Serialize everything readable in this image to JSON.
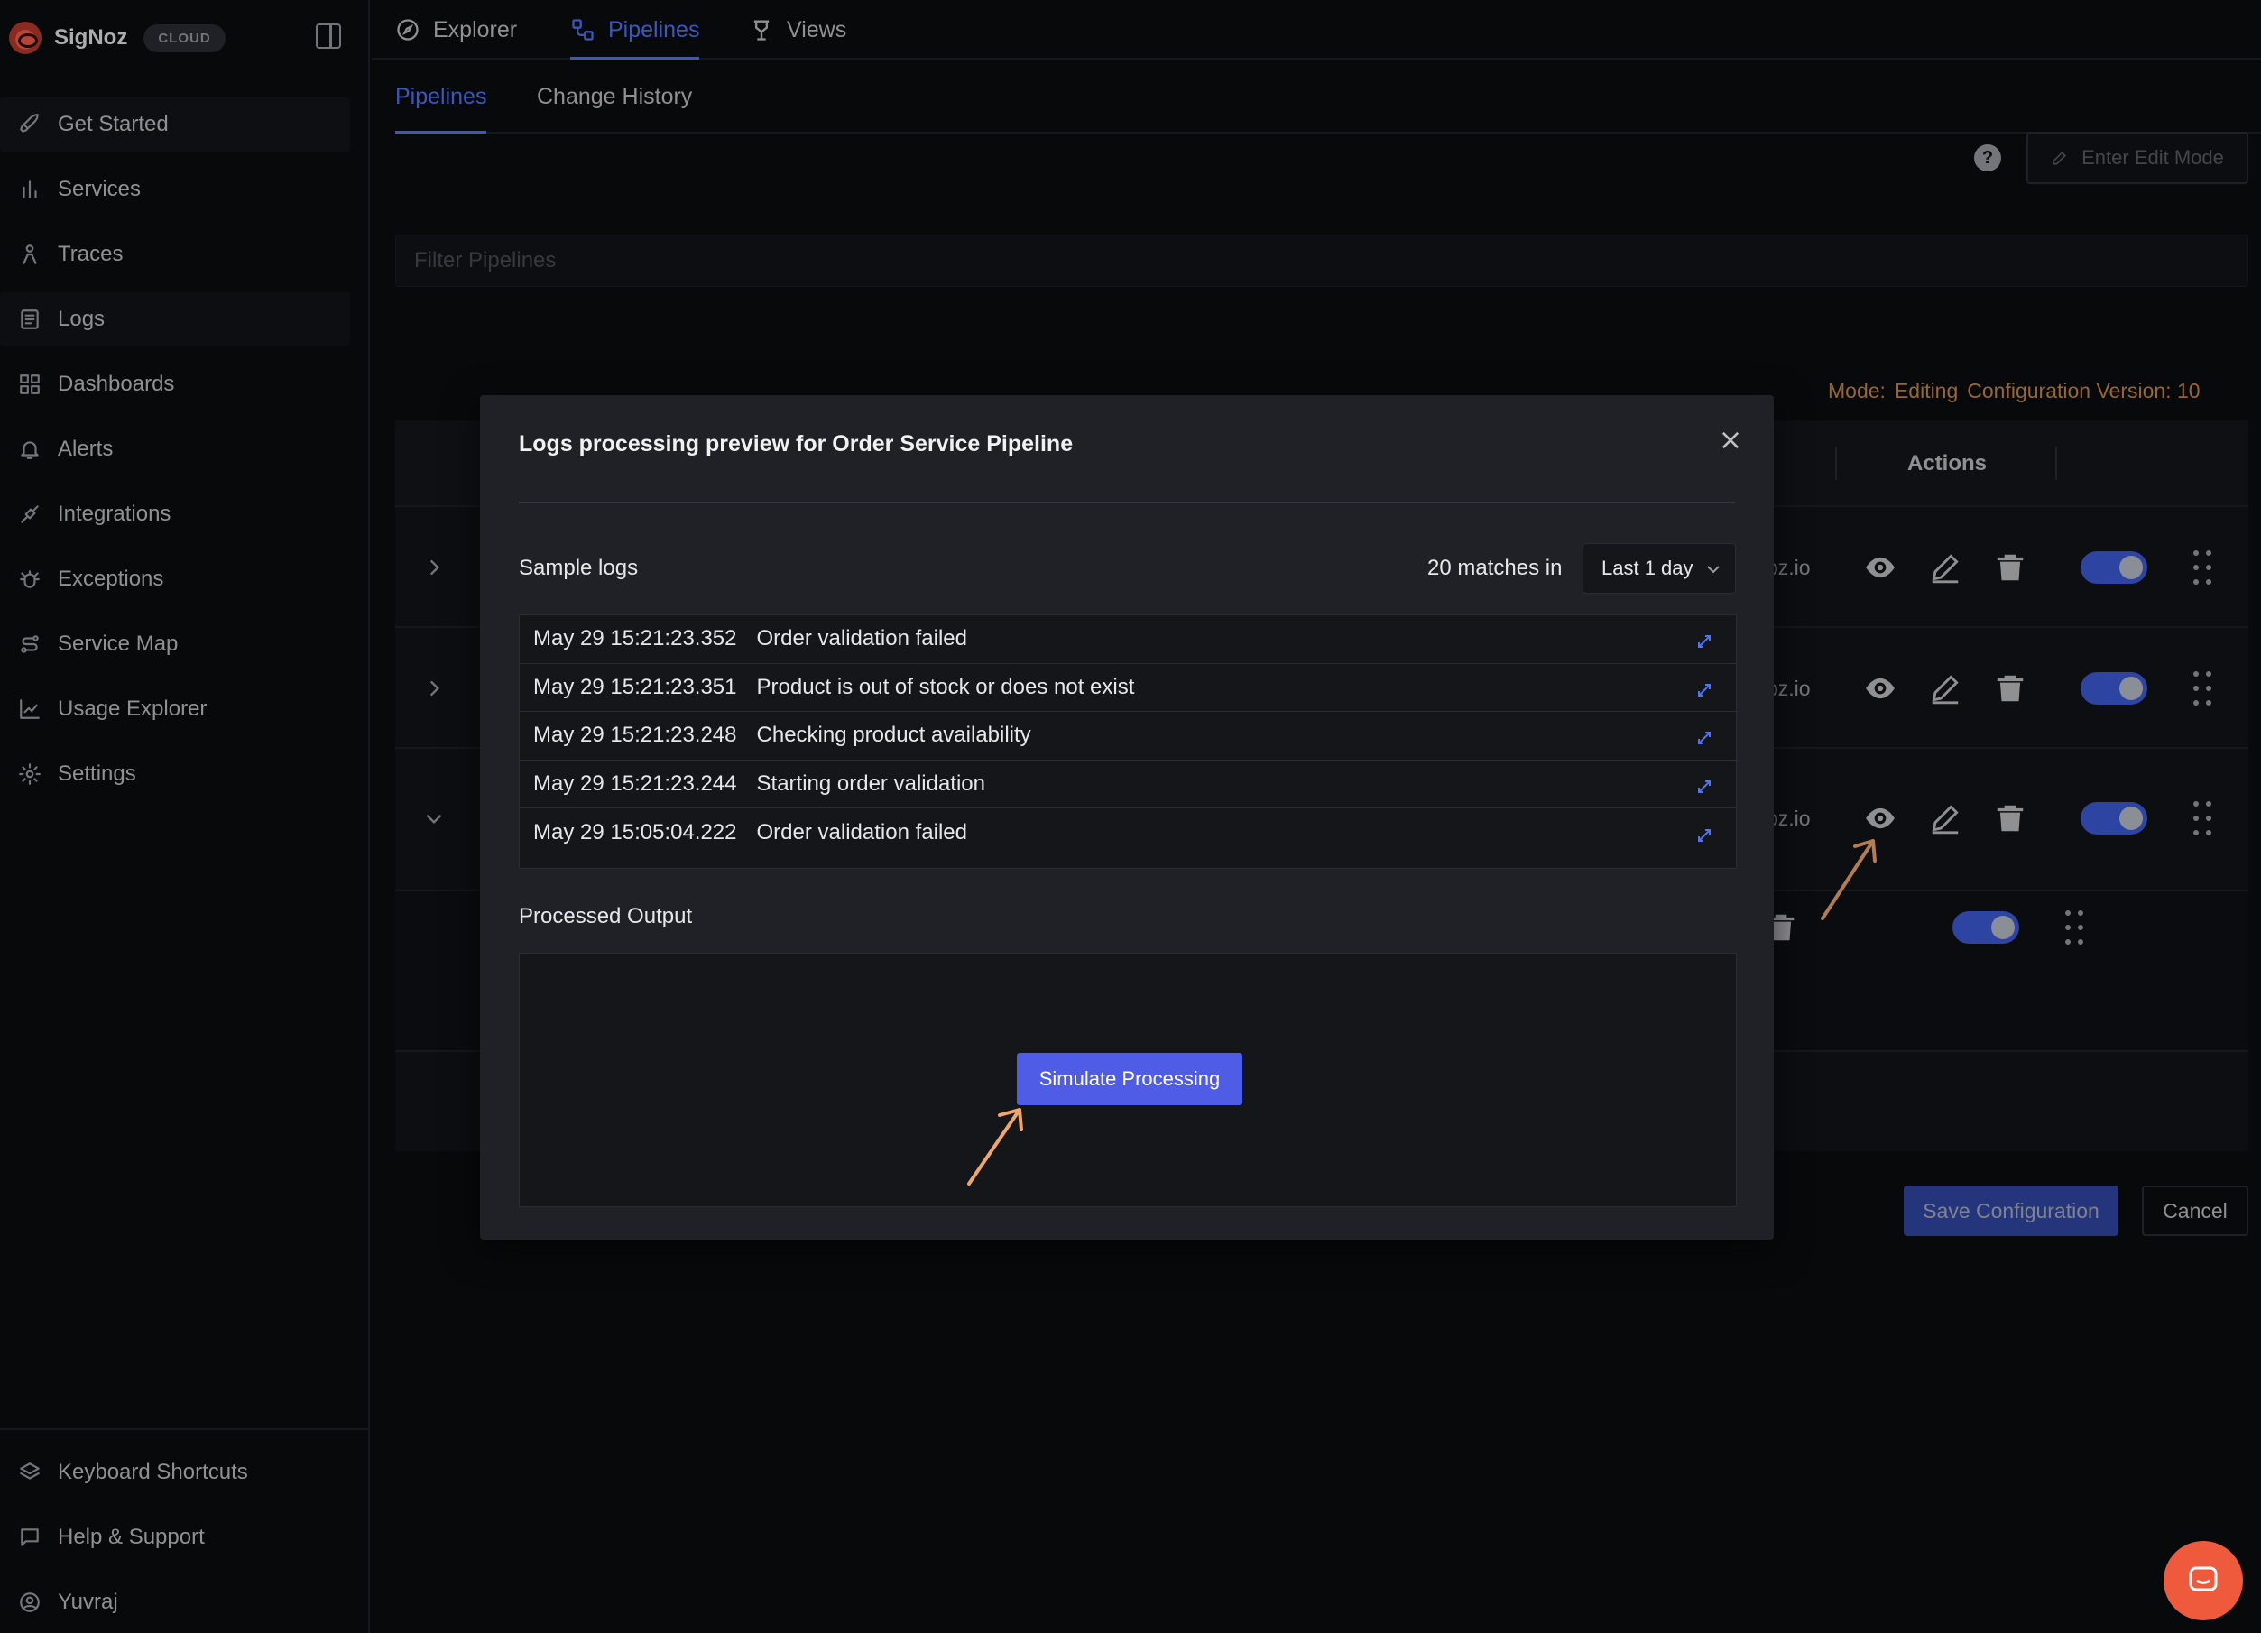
{
  "brand": {
    "name": "SigNoz",
    "badge": "CLOUD"
  },
  "sidebar": {
    "items": [
      {
        "label": "Get Started",
        "icon": "rocket-icon"
      },
      {
        "label": "Services",
        "icon": "bar-chart-icon"
      },
      {
        "label": "Traces",
        "icon": "traces-icon"
      },
      {
        "label": "Logs",
        "icon": "logs-icon"
      },
      {
        "label": "Dashboards",
        "icon": "dashboard-grid-icon"
      },
      {
        "label": "Alerts",
        "icon": "bell-icon"
      },
      {
        "label": "Integrations",
        "icon": "plug-icon"
      },
      {
        "label": "Exceptions",
        "icon": "bug-icon"
      },
      {
        "label": "Service Map",
        "icon": "route-icon"
      },
      {
        "label": "Usage Explorer",
        "icon": "line-chart-icon"
      },
      {
        "label": "Settings",
        "icon": "gear-icon"
      }
    ],
    "bottom": [
      {
        "label": "Keyboard Shortcuts",
        "icon": "layers-icon"
      },
      {
        "label": "Help & Support",
        "icon": "message-icon"
      },
      {
        "label": "Yuvraj",
        "icon": "user-circle-icon"
      }
    ]
  },
  "top_tabs": [
    {
      "label": "Explorer",
      "icon": "compass-icon"
    },
    {
      "label": "Pipelines",
      "icon": "workflow-icon"
    },
    {
      "label": "Views",
      "icon": "views-icon"
    }
  ],
  "sub_tabs": [
    {
      "label": "Pipelines"
    },
    {
      "label": "Change History"
    }
  ],
  "toolbar": {
    "help": "?",
    "edit_mode_label": "Enter Edit Mode"
  },
  "filter": {
    "placeholder": "Filter Pipelines"
  },
  "mode_line": {
    "mode_label": "Mode:",
    "mode_value": "Editing",
    "version_text": "Configuration Version: 10"
  },
  "table": {
    "actions_header": "Actions",
    "rows": [
      {
        "partial_text": "oz.io",
        "enabled": true
      },
      {
        "partial_text": "oz.io",
        "enabled": true
      },
      {
        "partial_text": "oz.io",
        "enabled": true
      }
    ]
  },
  "footer": {
    "save_label": "Save Configuration",
    "cancel_label": "Cancel"
  },
  "modal": {
    "title": "Logs processing preview for Order Service Pipeline",
    "sample_label": "Sample logs",
    "matches_text": "20 matches in",
    "range_value": "Last 1 day",
    "logs": [
      {
        "ts": "May 29 15:21:23.352",
        "msg": "Order validation failed"
      },
      {
        "ts": "May 29 15:21:23.351",
        "msg": "Product is out of stock or does not exist"
      },
      {
        "ts": "May 29 15:21:23.248",
        "msg": "Checking product availability"
      },
      {
        "ts": "May 29 15:21:23.244",
        "msg": "Starting order validation"
      },
      {
        "ts": "May 29 15:05:04.222",
        "msg": "Order validation failed"
      }
    ],
    "processed_label": "Processed Output",
    "simulate_label": "Simulate Processing"
  },
  "colors": {
    "accent": "#4e74f8",
    "toggle": "#3e5bd8",
    "mode_text": "#c98a3f",
    "annotation_arrow": "#f0a66b",
    "chat": "#ef5a3c"
  }
}
